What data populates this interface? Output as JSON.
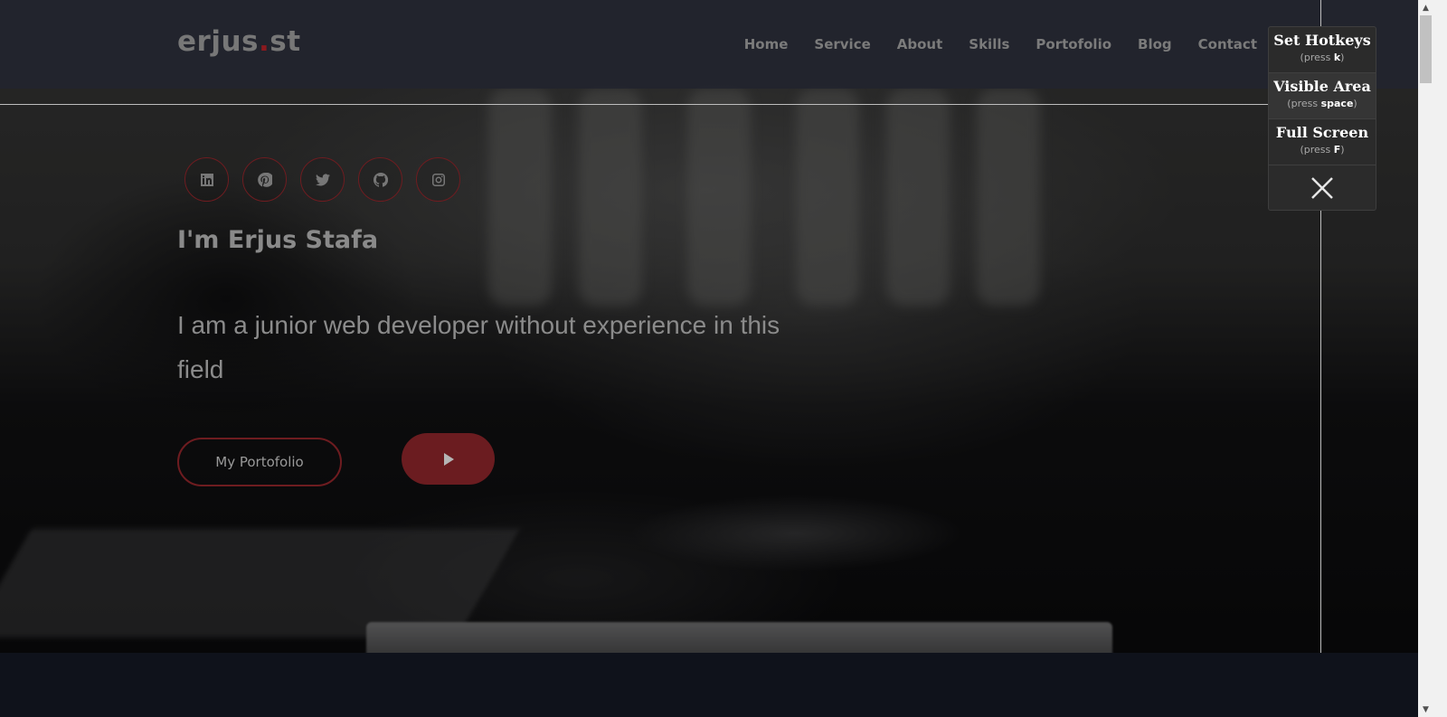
{
  "header": {
    "logo_main": "erjus",
    "logo_dot": ".",
    "logo_tail": "st",
    "nav": [
      "Home",
      "Service",
      "About",
      "Skills",
      "Portofolio",
      "Blog",
      "Contact"
    ]
  },
  "hero": {
    "socials": [
      "linkedin-icon",
      "pinterest-icon",
      "twitter-icon",
      "github-icon",
      "instagram-icon"
    ],
    "title": "I'm Erjus Stafa",
    "subtitle": "I am a junior web developer without experience in this field",
    "portfolio_button": "My Portofolio",
    "play_button": "play-icon"
  },
  "hotkey_panel": {
    "items": [
      {
        "label": "Set Hotkeys",
        "hint_prefix": "(press ",
        "key": "k",
        "hint_suffix": ")"
      },
      {
        "label": "Visible Area",
        "hint_prefix": "(press ",
        "key": "space",
        "hint_suffix": ")"
      },
      {
        "label": "Full Screen",
        "hint_prefix": "(press ",
        "key": "F",
        "hint_suffix": ")"
      }
    ],
    "close": "close-icon"
  },
  "colors": {
    "accent": "#6e1c20",
    "header_bg": "#22242e",
    "page_bg": "#0f121b"
  }
}
